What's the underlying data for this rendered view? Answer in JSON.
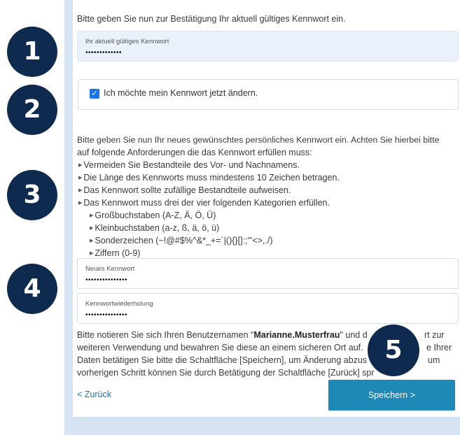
{
  "intro_text": "Bitte geben Sie nun zur Bestätigung Ihr aktuell gültiges Kennwort ein.",
  "current_password": {
    "label": "Ihr aktuell gültiges Kennwort",
    "value": "•••••••••••••"
  },
  "change_checkbox": {
    "checked": true,
    "label": "Ich möchte mein Kennwort jetzt ändern."
  },
  "requirements": {
    "line1": "Bitte geben Sie nun Ihr neues gewünschtes persönliches Kennwort ein. Achten Sie hierbei bitte",
    "line2": "auf folgende Anforderungen die das Kennwort erfüllen muss:",
    "rules": [
      "Vermeiden Sie Bestandteile des Vor- und Nachnamens.",
      "Die Länge des Kennworts muss mindestens 10 Zeichen betragen.",
      "Das Kennwort sollte zufällige Bestandteile aufweisen.",
      "Das Kennwort muss drei der vier folgenden Kategorien erfüllen."
    ],
    "categories": [
      "Großbuchstaben (A-Z, Ä, Ö, Ü)",
      "Kleinbuchstaben (a-z, ß, ä, ö, ü)",
      "Sonderzeichen (~!@#$%^&*_+=`|(){}[]:;\"'<>,./)",
      "Ziffern (0-9)"
    ]
  },
  "new_password": {
    "label": "Neues Kennwort",
    "value": "•••••••••••••••"
  },
  "repeat_password": {
    "label": "Kennwortwiederholung",
    "value": "•••••••••••••••"
  },
  "note": {
    "l1_pre": "Bitte notieren Sie sich Ihren Benutzernamen \"",
    "username": "Marianne.Musterfrau",
    "l1_post": "\" und d",
    "l1_end": "rt zur",
    "l2_pre": "weiteren Verwendung und bewahren Sie diese an einem sicheren Ort auf.",
    "l2_end": "e Ihrer",
    "l3_pre": "Daten betätigen Sie bitte die Schaltfläche [Speichern], um Änderung abzus",
    "l3_end": "um",
    "l4_pre": "vorherigen Schritt können Sie durch Betätigung der Schaltfläche [Zurück] spr"
  },
  "buttons": {
    "back": "< Zurück",
    "save": "Speichern >"
  },
  "badges": [
    "1",
    "2",
    "3",
    "4",
    "5"
  ],
  "colors": {
    "badge": "#0e2a4e",
    "accent": "#1e88b7",
    "checkbox": "#1a73e8",
    "frame": "#d6e3f2"
  }
}
